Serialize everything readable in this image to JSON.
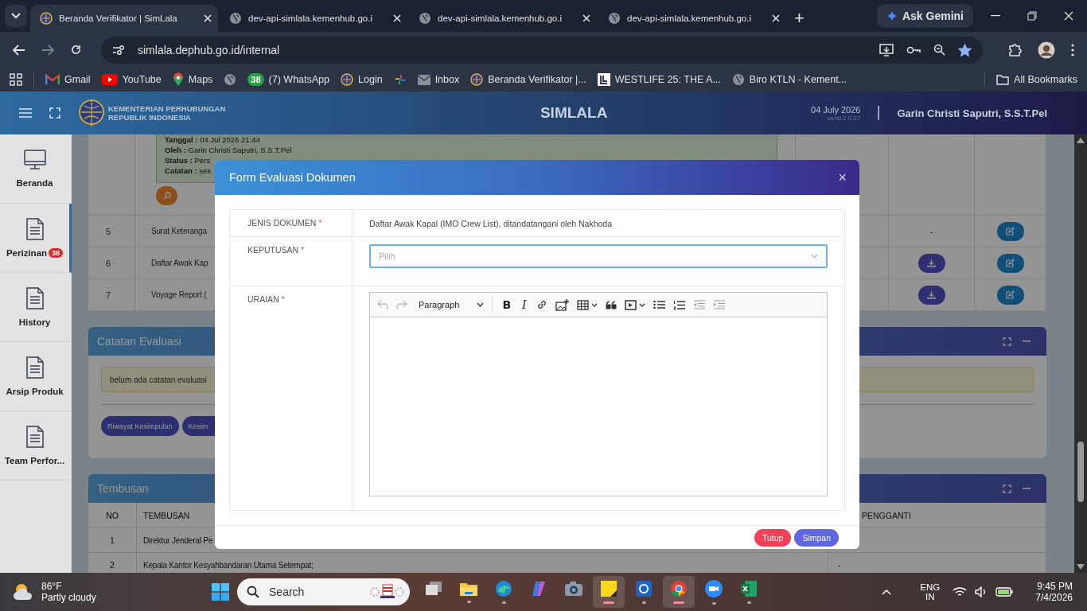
{
  "browser": {
    "tabs": [
      {
        "title": "Beranda Verifikator | SimLala",
        "selected": true
      },
      {
        "title": "dev-api-simlala.kemenhub.go.i",
        "selected": false
      },
      {
        "title": "dev-api-simlala.kemenhub.go.i",
        "selected": false
      },
      {
        "title": "dev-api-simlala.kemenhub.go.i",
        "selected": false
      }
    ],
    "new_tab": "+",
    "ask_gemini": "Ask Gemini",
    "address": "simlala.dephub.go.id/internal",
    "bookmarked": true,
    "bookmarks": [
      {
        "kind": "labeled",
        "label": "Gmail"
      },
      {
        "kind": "labeled",
        "label": "YouTube"
      },
      {
        "kind": "labeled",
        "label": "Maps"
      },
      {
        "kind": "icon"
      },
      {
        "kind": "badge",
        "badge": "38",
        "label": "(7) WhatsApp"
      },
      {
        "kind": "labeled",
        "label": "Login"
      },
      {
        "kind": "icon"
      },
      {
        "kind": "labeled",
        "label": "Inbox"
      },
      {
        "kind": "labeled",
        "label": "Beranda Verifikator |..."
      },
      {
        "kind": "labeled",
        "label": "WESTLIFE 25: THE A..."
      },
      {
        "kind": "labeled",
        "label": "Biro KTLN - Kement..."
      }
    ],
    "all_bookmarks": "All Bookmarks"
  },
  "app": {
    "org_line1": "KEMENTERIAN PERHUBUNGAN",
    "org_line2": "REPUBLIK INDONESIA",
    "title": "SIMLALA",
    "date": "04 July 2026",
    "version": "versi 2.0.27",
    "user": "Garin Christi Saputri, S.S.T.Pel"
  },
  "sidebar": [
    {
      "label": "Beranda",
      "selected": false
    },
    {
      "label": "Perizinan",
      "selected": true,
      "badge": "38"
    },
    {
      "label": "History",
      "selected": false
    },
    {
      "label": "Arsip Produk",
      "selected": false
    },
    {
      "label": "Team Perfor...",
      "selected": false
    }
  ],
  "documents": {
    "note": [
      "**Tanggal :** 04 Jul 2026 21:44",
      "**Oleh :** Garin Christi Saputri, S.S.T.Pel",
      "**Status :** Pers",
      "**Catatan :** ses"
    ],
    "rows": [
      {
        "no": "5",
        "name": "Surat Keteranga",
        "download": false,
        "column_4": "-"
      },
      {
        "no": "6",
        "name": "Daftar Awak Kap",
        "download": true
      },
      {
        "no": "7",
        "name": "Voyage Report (",
        "download": true
      }
    ]
  },
  "evaluation": {
    "title": "Catatan Evaluasi",
    "alert": "belum ada catatan evaluasi",
    "buttons": [
      "Riwayat Kesimpulan",
      "Kesim"
    ]
  },
  "tembusan": {
    "title": "Tembusan",
    "columns": [
      "NO",
      "TEMBUSAN",
      "PENGGANTI"
    ],
    "rows": [
      {
        "no": "1",
        "name": "Direktur Jenderal Pe"
      },
      {
        "no": "2",
        "name": "Kepala Kantor Kesyahbandaran Utama Setempat;",
        "replacement": "-"
      }
    ]
  },
  "modal": {
    "title": "Form Evaluasi Dokumen",
    "close": "×",
    "fields": [
      {
        "kind": "text",
        "label": "JENIS DOKUMEN",
        "required_mark": "*",
        "value": "Daftar Awak Kapal (IMO Crew List), ditandatangani oleh Nakhoda"
      },
      {
        "kind": "select",
        "label": "KEPUTUSAN",
        "required_mark": "*",
        "placeholder": "Pilih",
        "focused": true
      },
      {
        "kind": "editor",
        "label": "URAIAN",
        "required_mark": "*"
      }
    ],
    "editor": {
      "block_style": "Paragraph",
      "bold": "B",
      "italic": "I",
      "undo_disabled": true,
      "redo_disabled": true
    },
    "buttons": [
      {
        "kind": "cancel",
        "label": "Tutup"
      },
      {
        "kind": "submit",
        "label": "Simpan"
      }
    ]
  },
  "taskbar": {
    "temperature": "86°F",
    "weather": "Partly cloudy",
    "search": "Search",
    "language": "ENG",
    "region": "IN",
    "time": "9:45 PM",
    "date": "7/4/2026",
    "apps": [
      {
        "running": false,
        "focused": false
      },
      {
        "running": true,
        "focused": false
      },
      {
        "running": true,
        "focused": false
      },
      {
        "running": false,
        "focused": false
      },
      {
        "running": false,
        "focused": false
      },
      {
        "running": true,
        "focused": true
      },
      {
        "running": true,
        "focused": false
      },
      {
        "running": true,
        "focused": true
      },
      {
        "running": true,
        "focused": false
      },
      {
        "running": true,
        "focused": false
      }
    ]
  }
}
